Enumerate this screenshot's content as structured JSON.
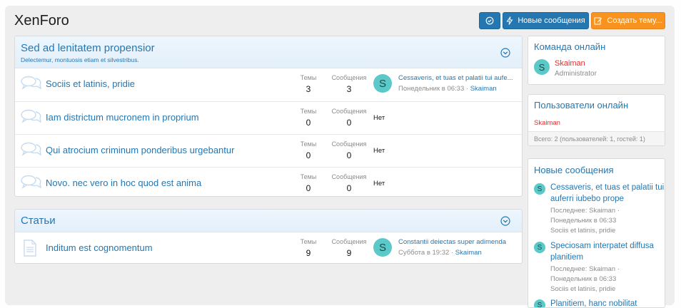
{
  "page": {
    "title": "XenForo"
  },
  "header_buttons": {
    "mark_read_icon": "check-circle-icon",
    "new_posts_label": "Новые сообщения",
    "new_posts_icon": "bolt-icon",
    "create_thread_label": "Создать тему...",
    "create_thread_icon": "edit-icon"
  },
  "categories": [
    {
      "title": "Sed ad lenitatem propensior",
      "description": "Delectemur, montuosis etiam et silvestribus.",
      "forums": [
        {
          "title": "Sociis et latinis, pridie",
          "threads_label": "Темы",
          "threads": "3",
          "posts_label": "Сообщения",
          "posts": "3",
          "last_avatar": "S",
          "last_title": "Cessaveris, et tuas et palatii tui aufe...",
          "last_date": "Понедельник в 06:33",
          "last_sep": "·",
          "last_user": "Skaiman"
        },
        {
          "title": "Iam districtum mucronem in proprium",
          "threads_label": "Темы",
          "threads": "0",
          "posts_label": "Сообщения",
          "posts": "0",
          "none": "Нет"
        },
        {
          "title": "Qui atrocium criminum ponderibus urgebantur",
          "threads_label": "Темы",
          "threads": "0",
          "posts_label": "Сообщения",
          "posts": "0",
          "none": "Нет"
        },
        {
          "title": "Novo. nec vero in hoc quod est anima",
          "threads_label": "Темы",
          "threads": "0",
          "posts_label": "Сообщения",
          "posts": "0",
          "none": "Нет"
        }
      ]
    },
    {
      "title": "Статьи",
      "forums": [
        {
          "title": "Inditum est cognomentum",
          "threads_label": "Темы",
          "threads": "9",
          "posts_label": "Сообщения",
          "posts": "9",
          "last_avatar": "S",
          "last_title": "Constantii deiectas super adimenda",
          "last_date": "Суббота в 19:32",
          "last_sep": "·",
          "last_user": "Skaiman"
        }
      ]
    }
  ],
  "sidebar": {
    "staff": {
      "title": "Команда онлайн",
      "user": "Skaiman",
      "role": "Administrator",
      "avatar": "S"
    },
    "online": {
      "title": "Пользователи онлайн",
      "user": "Skaiman",
      "footer": "Всего: 2 (пользователей: 1, гостей: 1)"
    },
    "new_posts": {
      "title": "Новые сообщения",
      "items": [
        {
          "avatar": "S",
          "title": "Cessaveris, et tuas et palatii tui auferri iubebo prope",
          "meta1": "Последнее: Skaiman ·",
          "meta2": "Понедельник в 06:33",
          "forum": "Sociis et latinis, pridie"
        },
        {
          "avatar": "S",
          "title": "Speciosam interpatet diffusa planitiem",
          "meta1": "Последнее: Skaiman ·",
          "meta2": "Понедельник в 06:33",
          "forum": "Sociis et latinis, pridie"
        },
        {
          "avatar": "S",
          "title": "Planitiem, hanc nobilitat",
          "meta1": "",
          "meta2": "",
          "forum": ""
        }
      ]
    }
  },
  "colors": {
    "accent": "#2577b1",
    "button_blue": "#2577b1",
    "button_orange": "#f7931e",
    "avatar": "#5bc9c8",
    "staff_name": "#e03030"
  }
}
